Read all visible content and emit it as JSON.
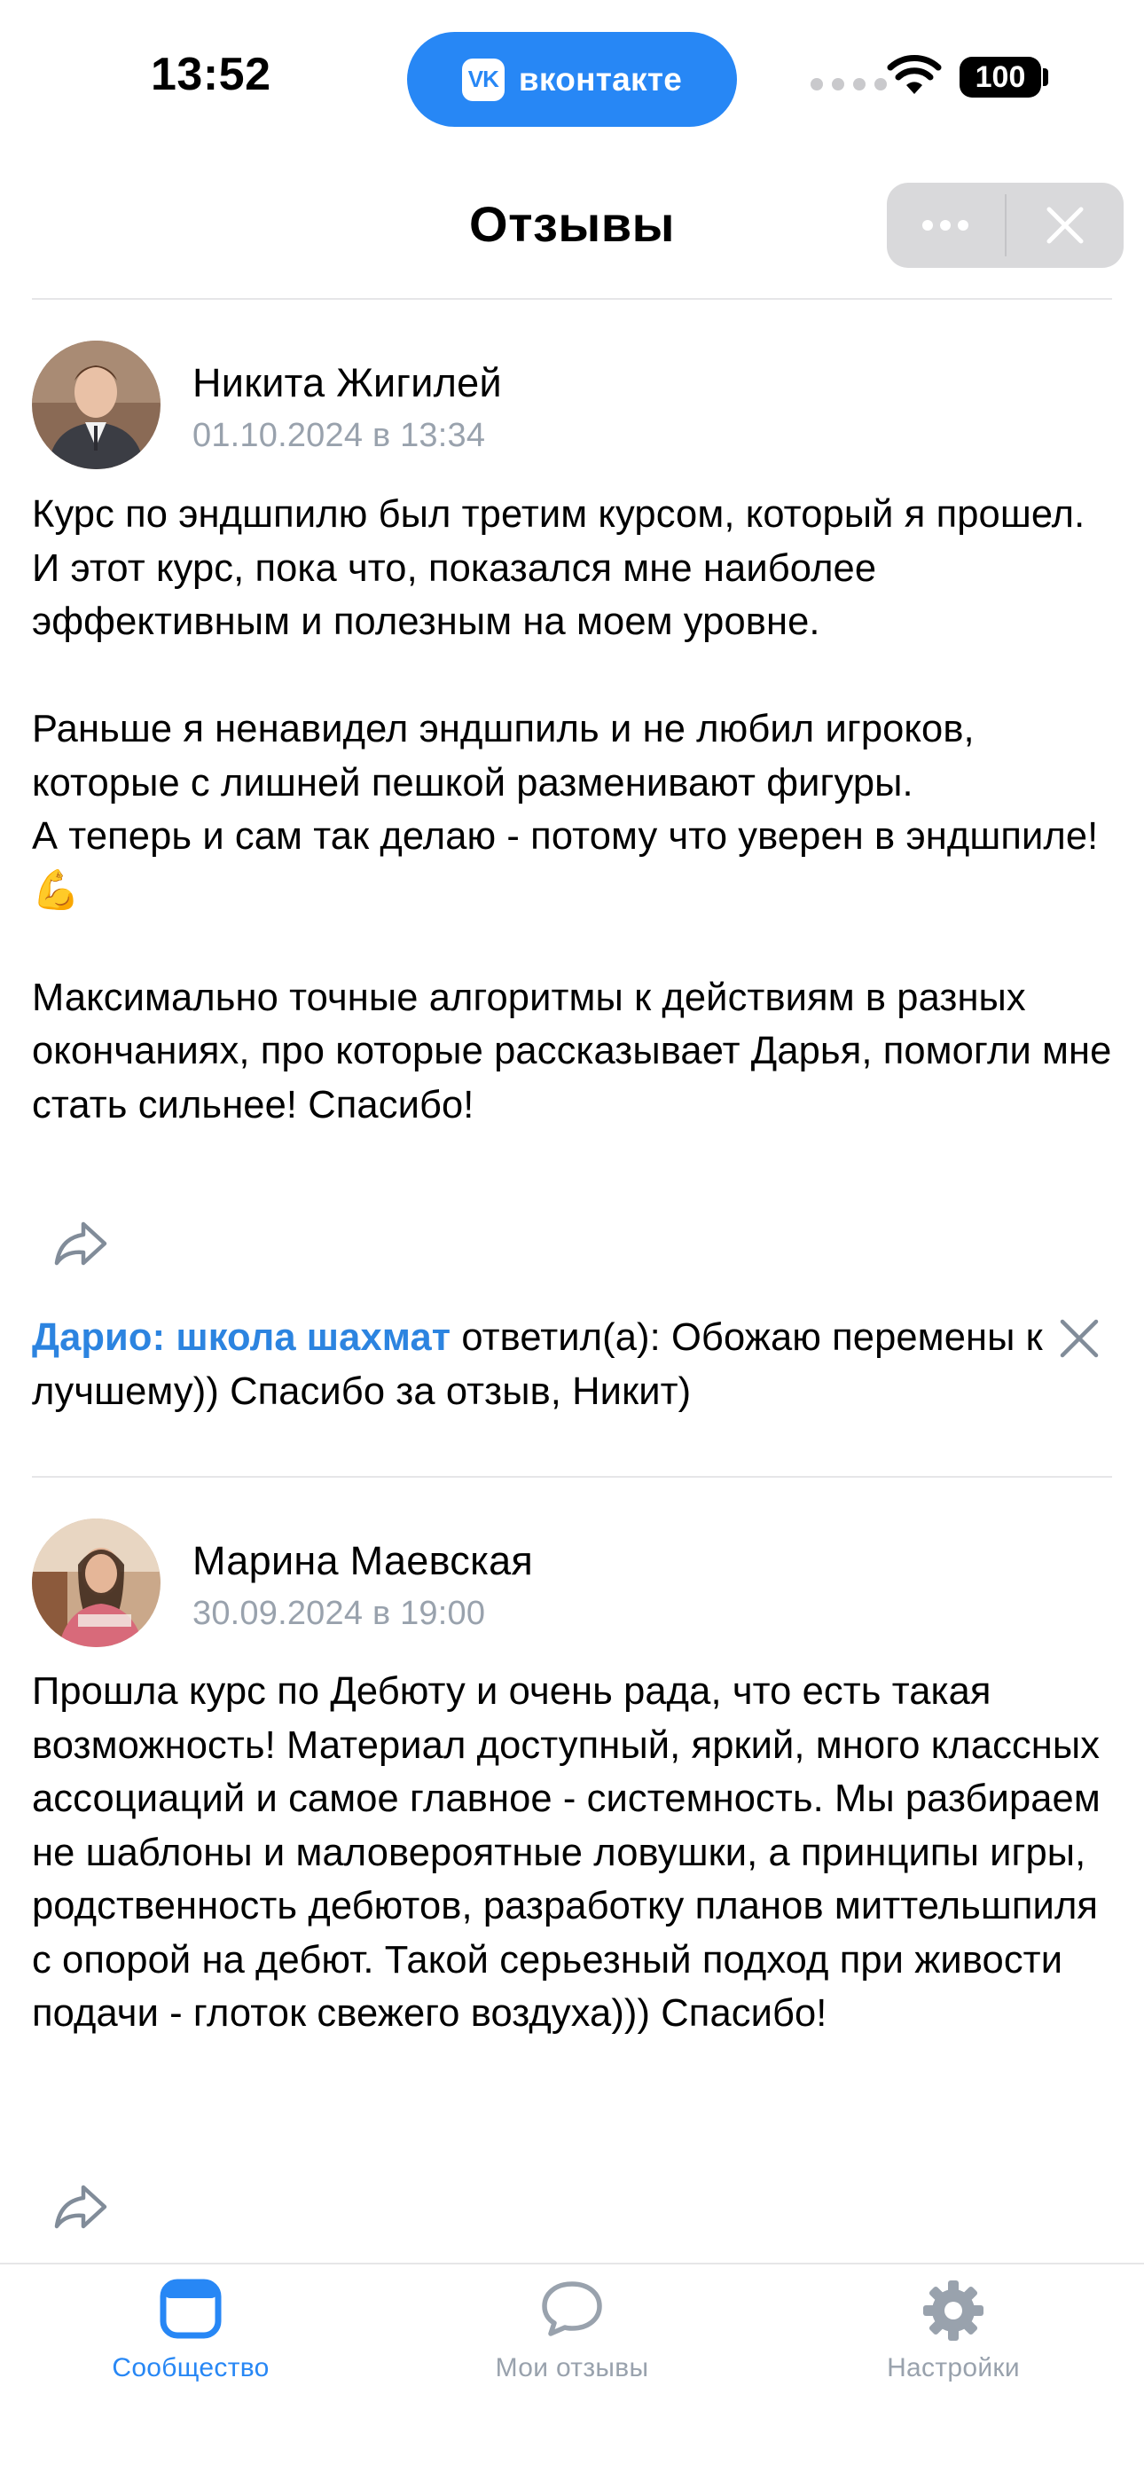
{
  "status_bar": {
    "time": "13:52",
    "app_pill_label": "вконтакте",
    "app_pill_logo": "VK",
    "battery": "100",
    "accent_color": "#2787f5"
  },
  "header": {
    "title": "Отзывы",
    "more_icon": "more-horizontal-icon",
    "close_icon": "close-icon"
  },
  "reviews": [
    {
      "author": "Никита Жигилей",
      "date": "01.10.2024 в 13:34",
      "text": "Курс по эндшпилю был третим курсом, который я прошел.\nИ этот курс, пока что, показался мне наиболее эффективным и полезным на моем уровне.\n\nРаньше я ненавидел эндшпиль и не любил игроков, которые с лишней пешкой разменивают фигуры.\nА теперь и сам так делаю - потому что уверен в эндшпиле! 💪\n\nМаксимально точные алгоритмы к действиям в разных окончаниях, про которые рассказывает Дарья, помогли мне стать сильнее! Спасибо!",
      "reply": {
        "author": "Дарио: школа шахмат",
        "text": " ответил(а): Обожаю перемены к лучшему)) Спасибо за отзыв, Никит)"
      }
    },
    {
      "author": "Марина Маевская",
      "date": "30.09.2024 в 19:00",
      "text": "Прошла курс по Дебюту и очень рада, что есть такая возможность! Материал доступный, яркий, много классных ассоциаций и самое главное - системность. Мы разбираем не шаблоны и маловероятные ловушки, а принципы игры, родственность дебютов, разработку планов миттельшпиля с опорой на дебют. Такой серьезный подход при живости подачи - глоток свежего воздуха))) Спасибо!"
    }
  ],
  "tabs": [
    {
      "label": "Сообщество",
      "icon": "community-icon",
      "active": true
    },
    {
      "label": "Мои отзывы",
      "icon": "speech-bubble-icon",
      "active": false
    },
    {
      "label": "Настройки",
      "icon": "gear-icon",
      "active": false
    }
  ]
}
